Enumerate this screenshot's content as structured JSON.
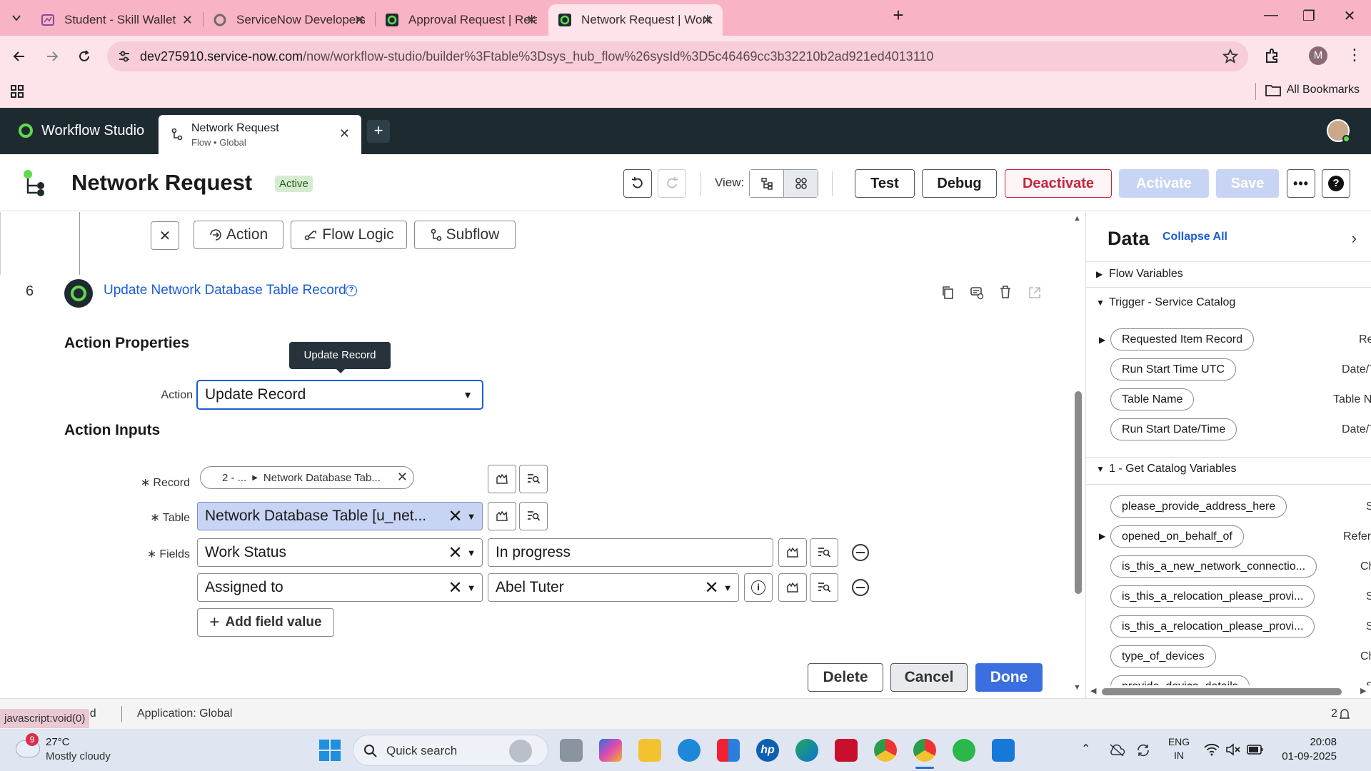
{
  "browser": {
    "tabs": [
      {
        "title": "Student - Skill Wallet",
        "icon": "skill-wallet-icon"
      },
      {
        "title": "ServiceNow Developers",
        "icon": "servicenow-icon"
      },
      {
        "title": "Approval Request | Relationship",
        "icon": "servicenow-green-icon"
      },
      {
        "title": "Network Request | Workflow Stu",
        "icon": "servicenow-green-icon"
      }
    ],
    "url_host": "dev275910.service-now.com",
    "url_path": "/now/workflow-studio/builder%3Ftable%3Dsys_hub_flow%26sysId%3D5c46469cc3b32210b2ad921ed4013110",
    "profile_initial": "M",
    "all_bookmarks": "All Bookmarks"
  },
  "studio": {
    "brand": "Workflow Studio",
    "tab_title": "Network Request",
    "tab_subtitle": "Flow • Global",
    "flow_title": "Network Request",
    "status_badge": "Active",
    "view_label": "View:",
    "buttons": {
      "test": "Test",
      "debug": "Debug",
      "deactivate": "Deactivate",
      "activate": "Activate",
      "save": "Save"
    },
    "accent": "#1a5dd6",
    "danger": "#c3243d"
  },
  "toolbar": {
    "action": "Action",
    "flow_logic": "Flow Logic",
    "subflow": "Subflow"
  },
  "step": {
    "number": "6",
    "title": "Update Network Database Table Record",
    "action_properties": "Action Properties",
    "tooltip": "Update Record",
    "action_label": "Action",
    "action_value": "Update Record",
    "action_inputs": "Action Inputs",
    "record_label": "Record",
    "record_pill_prefix": "2 - ...",
    "record_pill_value": "Network Database Tab...",
    "table_label": "Table",
    "table_value": "Network Database Table [u_net...",
    "fields_label": "Fields",
    "fields": [
      {
        "field": "Work Status",
        "value": "In progress"
      },
      {
        "field": "Assigned to",
        "value": "Abel Tuter"
      }
    ],
    "add_field": "Add field value",
    "delete": "Delete",
    "cancel": "Cancel",
    "done": "Done"
  },
  "data_panel": {
    "title": "Data",
    "collapse_all": "Collapse All",
    "flow_variables": "Flow Variables",
    "trigger_section": "Trigger - Service Catalog",
    "trigger_items": [
      {
        "label": "Requested Item Record",
        "type": "Re"
      },
      {
        "label": "Run Start Time UTC",
        "type": "Date/T"
      },
      {
        "label": "Table Name",
        "type": "Table N"
      },
      {
        "label": "Run Start Date/Time",
        "type": "Date/T"
      }
    ],
    "catalog_section": "1 - Get Catalog Variables",
    "catalog_items": [
      {
        "label": "please_provide_address_here",
        "type": "St"
      },
      {
        "label": "opened_on_behalf_of",
        "type": "Refere"
      },
      {
        "label": "is_this_a_new_network_connectio...",
        "type": "Ch"
      },
      {
        "label": "is_this_a_relocation_please_provi...",
        "type": "St"
      },
      {
        "label": "is_this_a_relocation_please_provi...",
        "type": "St"
      },
      {
        "label": "type_of_devices",
        "type": "Ch"
      },
      {
        "label": "provide_device_details",
        "type": "St"
      }
    ]
  },
  "status_bar": {
    "js": "javascript:void(0)",
    "left_fragment": "ned",
    "application": "Application: Global",
    "count": "2"
  },
  "taskbar": {
    "weather_badge": "9",
    "temperature": "27°C",
    "weather": "Mostly cloudy",
    "search": "Quick search",
    "lang_top": "ENG",
    "lang_bottom": "IN",
    "time": "20:08",
    "date": "01-09-2025"
  }
}
